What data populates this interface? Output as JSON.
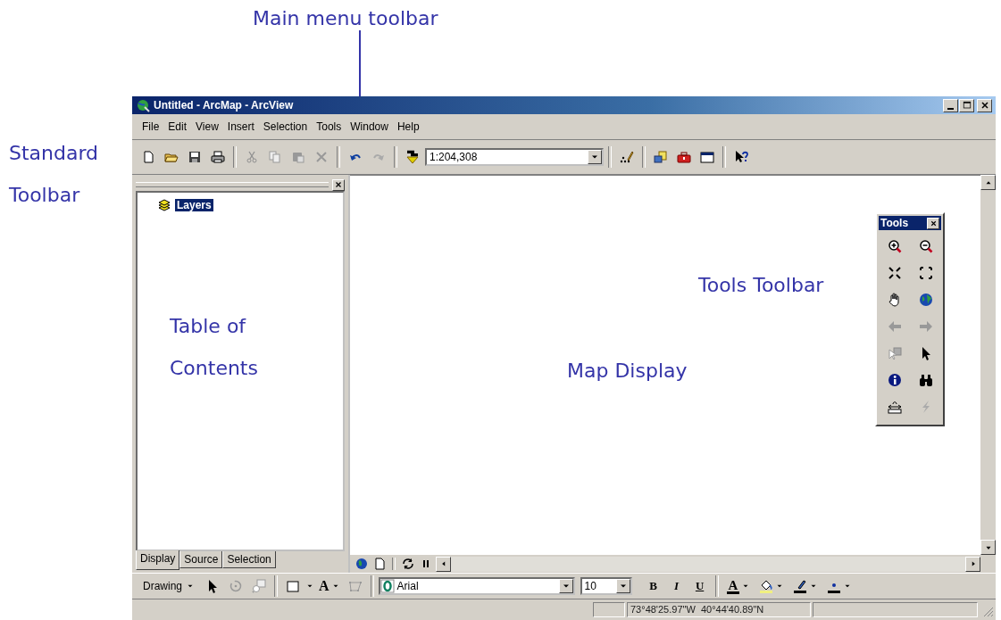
{
  "menu_annotation": {
    "text": "Main menu toolbar"
  },
  "window": {
    "title": "Untitled - ArcMap - ArcView"
  },
  "menu_bar": {
    "items": [
      "File",
      "Edit",
      "View",
      "Insert",
      "Selection",
      "Tools",
      "Window",
      "Help"
    ]
  },
  "standard_toolbar": {
    "annotation": "Standard Toolbar",
    "scale": "1:204,308"
  },
  "toc": {
    "annotation": "Table of Contents",
    "layers": [
      {
        "label": "Layers",
        "selected": true
      }
    ],
    "tabs": [
      {
        "label": "Display",
        "selected": true
      },
      {
        "label": "Source",
        "selected": false
      },
      {
        "label": "Selection",
        "selected": false
      }
    ]
  },
  "map": {
    "annotation": "Map Display"
  },
  "tools_toolbar": {
    "title": "Tools",
    "annotation": "Tools Toolbar"
  },
  "drawing_toolbar": {
    "menu": "Drawing",
    "text_tool": "A",
    "font": "Arial",
    "size": "10",
    "styles": [
      "B",
      "I",
      "U"
    ],
    "font_color": "A"
  },
  "status_bar": {
    "coordinates": "73°48'25.97\"W  40°44'40.89\"N"
  }
}
